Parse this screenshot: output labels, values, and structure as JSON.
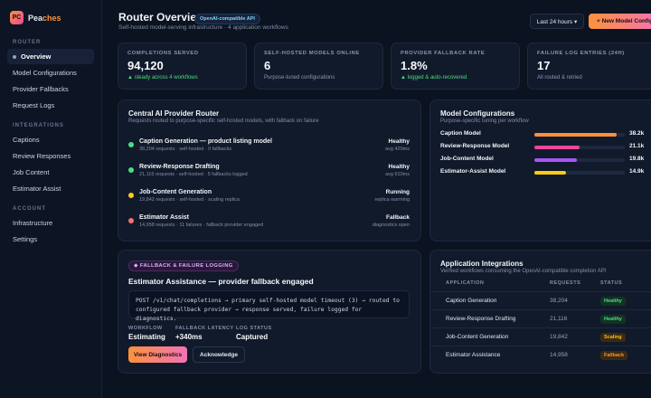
{
  "brand": {
    "logo": "PC",
    "name_a": "Pea",
    "name_b": "ches"
  },
  "sidebar": {
    "sections": [
      {
        "label": "ROUTER",
        "items": [
          "Overview",
          "Model Configurations",
          "Provider Fallbacks",
          "Request Logs"
        ]
      },
      {
        "label": "INTEGRATIONS",
        "items": [
          "Captions",
          "Review Responses",
          "Job Content",
          "Estimator Assist"
        ]
      },
      {
        "label": "ACCOUNT",
        "items": [
          "Infrastructure",
          "Settings"
        ]
      }
    ],
    "active_item": "Overview"
  },
  "header": {
    "title": "Router Overview",
    "badge": "OpenAI-compatible API",
    "subtitle": "Self-hosted model-serving infrastructure · 4 application workflows",
    "range_button": "Last 24 hours ▾",
    "new_button": "+ New Model Config"
  },
  "stats": [
    {
      "label": "COMPLETIONS SERVED",
      "value": "94,120",
      "note": "▲ steady across 4 workflows",
      "note_good": true
    },
    {
      "label": "SELF-HOSTED MODELS ONLINE",
      "value": "6",
      "note": "Purpose-tuned configurations",
      "note_good": false
    },
    {
      "label": "PROVIDER FALLBACK RATE",
      "value": "1.8%",
      "note": "▲ logged & auto-recovered",
      "note_good": true
    },
    {
      "label": "FAILURE LOG ENTRIES (24H)",
      "value": "17",
      "note": "All routed & retried",
      "note_good": false
    }
  ],
  "router_panel": {
    "title": "Central AI Provider Router",
    "subtitle": "Requests routed to purpose-specific self-hosted models, with fallback on failure",
    "routes": [
      {
        "name": "Caption Generation — product listing model",
        "meta": "38,204 requests · self-hosted · 0 fallbacks",
        "status": "Healthy",
        "detail": "avg 420ms",
        "color": "#4ade80"
      },
      {
        "name": "Review-Response Drafting",
        "meta": "21,116 requests · self-hosted · 5 fallbacks logged",
        "status": "Healthy",
        "detail": "avg 610ms",
        "color": "#4ade80"
      },
      {
        "name": "Job-Content Generation",
        "meta": "19,842 requests · self-hosted · scaling replica",
        "status": "Running",
        "detail": "replica warming",
        "color": "#facc15"
      },
      {
        "name": "Estimator Assist",
        "meta": "14,958 requests · 11 failures · fallback provider engaged",
        "status": "Fallback",
        "detail": "diagnostics open",
        "color": "#f87171"
      }
    ]
  },
  "models_panel": {
    "title": "Model Configurations",
    "subtitle": "Purpose-specific tuning per workflow",
    "models": [
      {
        "name": "Caption Model",
        "value_label": "38.2k",
        "value": 38.2,
        "color": "#fb923c"
      },
      {
        "name": "Review-Response Model",
        "value_label": "21.1k",
        "value": 21.1,
        "color": "#ec4899"
      },
      {
        "name": "Job-Content Model",
        "value_label": "19.8k",
        "value": 19.8,
        "color": "#a855f7"
      },
      {
        "name": "Estimator-Assist Model",
        "value_label": "14.9k",
        "value": 14.9,
        "color": "#facc15"
      }
    ]
  },
  "fallback_panel": {
    "chip": "◆ FALLBACK & FAILURE LOGGING",
    "title": "Estimator Assistance — provider fallback engaged",
    "code_line1": "POST /v1/chat/completions → primary self-hosted model timeout (3) → routed to",
    "code_line2": "configured fallback provider → response served, failure logged for diagnostics.",
    "meta": [
      {
        "label": "WORKFLOW",
        "value": "Estimating"
      },
      {
        "label": "FALLBACK LATENCY",
        "value": "+340ms"
      },
      {
        "label": "LOG STATUS",
        "value": "Captured"
      }
    ],
    "view_button": "View Diagnostics",
    "ack_button": "Acknowledge"
  },
  "integrations_panel": {
    "title": "Application Integrations",
    "subtitle": "Verified workflows consuming the OpenAI-compatible completion API",
    "columns": [
      "APPLICATION",
      "REQUESTS",
      "STATUS"
    ],
    "rows": [
      {
        "app": "Caption Generation",
        "requests": "38,204",
        "status": "Healthy",
        "bg": "#123322",
        "fg": "#4ade80"
      },
      {
        "app": "Review-Response Drafting",
        "requests": "21,116",
        "status": "Healthy",
        "bg": "#123322",
        "fg": "#4ade80"
      },
      {
        "app": "Job-Content Generation",
        "requests": "19,842",
        "status": "Scaling",
        "bg": "#3a2a10",
        "fg": "#fbbf24"
      },
      {
        "app": "Estimator Assistance",
        "requests": "14,958",
        "status": "Fallback",
        "bg": "#3a2a10",
        "fg": "#fb923c"
      }
    ]
  }
}
